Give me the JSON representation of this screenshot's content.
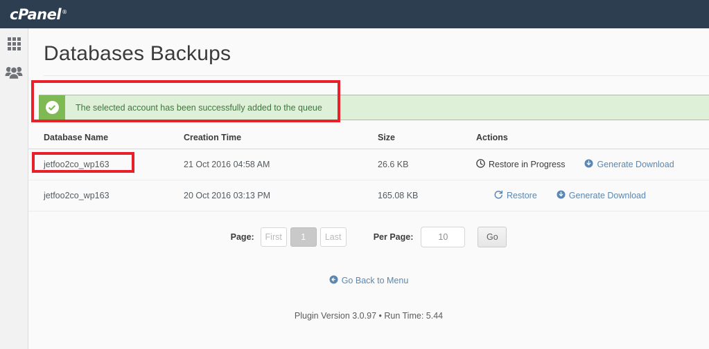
{
  "topbar": {
    "logo_text": "cPanel",
    "logo_mark": "®"
  },
  "sidebar": {
    "items": [
      {
        "name": "apps-grid",
        "icon": "grid-icon",
        "label": ""
      },
      {
        "name": "users",
        "icon": "users-icon",
        "label": ""
      }
    ]
  },
  "page": {
    "title": "Databases Backups"
  },
  "alert": {
    "icon": "check-circle-icon",
    "message": "The selected account has been successfully added to the queue",
    "bg_color": "#dff0d8",
    "icon_bg_color": "#7fb953",
    "text_color": "#3c763d"
  },
  "annotations": {
    "highlight_color": "#e8202a",
    "boxes": [
      "alert-banner",
      "restore-in-progress-action"
    ]
  },
  "table": {
    "columns": [
      "Database Name",
      "Creation Time",
      "Size",
      "Actions"
    ],
    "rows": [
      {
        "database_name": "jetfoo2co_wp163",
        "creation_time": "21 Oct 2016 04:58 AM",
        "size": "26.6 KB",
        "actions": [
          {
            "label": "Restore in Progress",
            "icon": "clock-icon",
            "state": "disabled"
          },
          {
            "label": "Generate Download",
            "icon": "download-circle-icon",
            "state": "link"
          }
        ]
      },
      {
        "database_name": "jetfoo2co_wp163",
        "creation_time": "20 Oct 2016 03:13 PM",
        "size": "165.08 KB",
        "actions": [
          {
            "label": "Restore",
            "icon": "refresh-icon",
            "state": "link"
          },
          {
            "label": "Generate Download",
            "icon": "download-circle-icon",
            "state": "link"
          }
        ]
      }
    ]
  },
  "pagination": {
    "page_label": "Page:",
    "first_label": "First",
    "current_page": "1",
    "last_label": "Last",
    "per_page_label": "Per Page:",
    "per_page_value": "10",
    "per_page_placeholder": "10",
    "go_label": "Go"
  },
  "footer": {
    "back_link": "Go Back to Menu",
    "back_icon": "arrow-left-circle-icon",
    "version_text": "Plugin Version 3.0.97 • Run Time: 5.44"
  },
  "colors": {
    "topbar": "#2d3e50",
    "link": "#5b87b0",
    "accent_green": "#7fb953"
  }
}
